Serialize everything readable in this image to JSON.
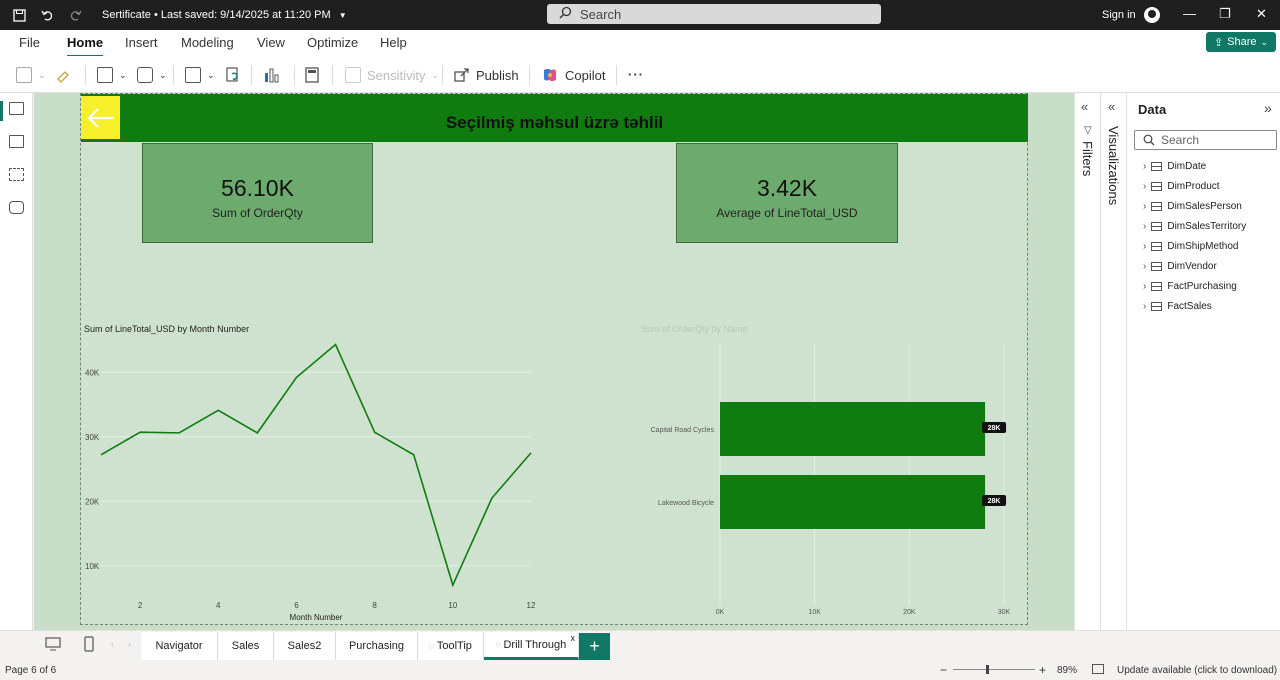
{
  "titlebar": {
    "doc_title": "Sertificate • Last saved: 9/14/2025 at 11:20 PM",
    "search_placeholder": "Search",
    "sign_in": "Sign in"
  },
  "menu": {
    "items": [
      "File",
      "Home",
      "Insert",
      "Modeling",
      "View",
      "Optimize",
      "Help"
    ],
    "active": "Home",
    "share_label": "Share"
  },
  "ribbon": {
    "sensitivity_label": "Sensitivity",
    "publish_label": "Publish",
    "copilot_label": "Copilot",
    "more_label": "···"
  },
  "report": {
    "heading": "Seçilmiş məhsul üzrə təhlil",
    "kpis": [
      {
        "value": "56.10K",
        "label": "Sum of OrderQty"
      },
      {
        "value": "3.42K",
        "label": "Average of LineTotal_USD"
      }
    ]
  },
  "line_chart_title": "Sum of LineTotal_USD by Month Number",
  "bar_chart_title": "Sum of OrderQty by Name",
  "chart_data": [
    {
      "type": "line",
      "title": "Sum of LineTotal_USD by Month Number",
      "xlabel": "Month Number",
      "ylabel": "",
      "x": [
        1,
        2,
        3,
        4,
        5,
        6,
        7,
        8,
        9,
        10,
        11,
        12
      ],
      "values": [
        27200,
        30700,
        30600,
        34100,
        30600,
        39200,
        44300,
        30700,
        27200,
        7000,
        20500,
        27500
      ],
      "x_ticks": [
        "2",
        "4",
        "6",
        "8",
        "10",
        "12"
      ],
      "y_ticks": [
        "10K",
        "20K",
        "30K",
        "40K"
      ],
      "xlim": [
        1,
        12
      ],
      "ylim": [
        5000,
        45000
      ],
      "color": "#107c10",
      "grid": true
    },
    {
      "type": "bar",
      "orientation": "horizontal",
      "title": "Sum of OrderQty by Name",
      "categories": [
        "Capital Road Cycles",
        "Lakewood Bicycle"
      ],
      "values": [
        28000,
        28000
      ],
      "data_labels": [
        "28K",
        "28K"
      ],
      "x_ticks": [
        "0K",
        "10K",
        "20K",
        "30K"
      ],
      "xlim": [
        0,
        30000
      ],
      "color": "#107c10",
      "grid": true
    }
  ],
  "panels": {
    "filters_label": "Filters",
    "visualizations_label": "Visualizations",
    "data_title": "Data",
    "data_search_placeholder": "Search",
    "tables": [
      "DimDate",
      "DimProduct",
      "DimSalesPerson",
      "DimSalesTerritory",
      "DimShipMethod",
      "DimVendor",
      "FactPurchasing",
      "FactSales"
    ]
  },
  "tabs": [
    "Navigator",
    "Sales",
    "Sales2",
    "Purchasing",
    "ToolTip",
    "Drill Through"
  ],
  "active_tab": "Drill Through",
  "status": {
    "page": "Page 6 of 6",
    "zoom": "89%",
    "update": "Update available (click to download)"
  }
}
